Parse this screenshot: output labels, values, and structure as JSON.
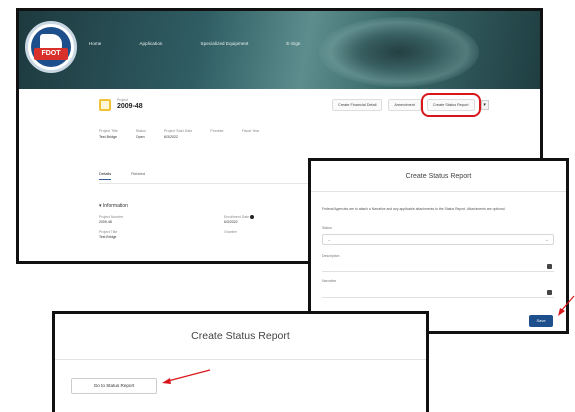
{
  "main": {
    "logo": {
      "text": "FDOT",
      "icon": "fdot-logo-icon"
    },
    "nav": [
      "Home",
      "Application",
      "Specialized Equipment",
      "E-Sign"
    ],
    "project": {
      "small_label": "Project",
      "title": "2009-48"
    },
    "top_buttons": [
      "Create Financial Detail",
      "Amendment",
      "Create Status Report"
    ],
    "more_label": "▾",
    "fields": [
      {
        "label": "Project Title",
        "value": "Test Bridge"
      },
      {
        "label": "Status",
        "value": "Open"
      },
      {
        "label": "Project Start Date",
        "value": "6/3/2022"
      },
      {
        "label": "Provider",
        "value": ""
      },
      {
        "label": "Fiscal Year",
        "value": ""
      }
    ],
    "tabs": [
      "Details",
      "Related"
    ],
    "info_heading": "Information",
    "info_fields": [
      {
        "label": "Project Number",
        "value": "2009-48"
      },
      {
        "label": "Enrollment Date",
        "value": "6/3/2022"
      },
      {
        "label": "Project Title",
        "value": "Test Bridge"
      },
      {
        "label": "Grantee",
        "value": ""
      }
    ]
  },
  "modal1": {
    "title": "Create Status Report",
    "description": "Federal Agencies are to attach a Narrative and any applicable attachments to the Status Report. Attachments are optional.",
    "status_label": "Status",
    "status_value": "--",
    "description_label": "Description",
    "narrative_label": "Narrative",
    "save_label": "Save",
    "colors": {
      "primary": "#1d4f8c"
    }
  },
  "modal2": {
    "title": "Create Status Report",
    "goto_label": "Go to Status Report"
  },
  "colors": {
    "highlight": "#d9161c",
    "accent": "#1d4f8c"
  }
}
